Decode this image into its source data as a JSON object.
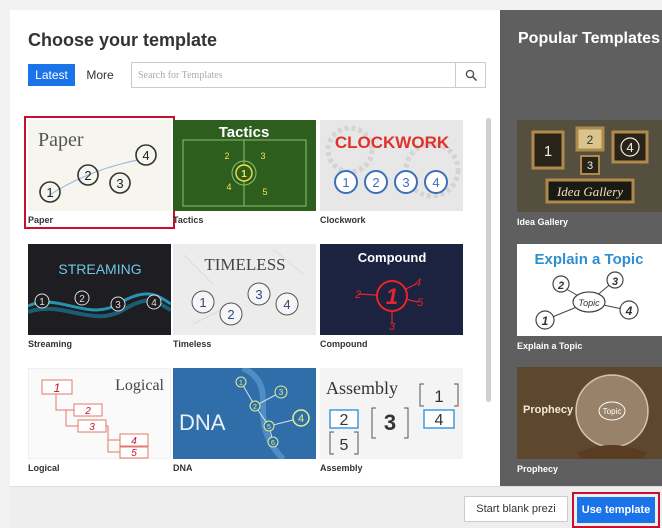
{
  "dialog": {
    "title": "Choose your template",
    "tabs": {
      "latest": "Latest",
      "more": "More"
    },
    "search": {
      "placeholder": "Search for Templates",
      "value": "",
      "icon": "search-icon"
    }
  },
  "templates": [
    {
      "label": "Paper",
      "thumb_title": "Paper",
      "selected": true,
      "nums": [
        "1",
        "2",
        "3",
        "4"
      ]
    },
    {
      "label": "Tactics",
      "thumb_title": "Tactics",
      "nums": [
        "1",
        "2",
        "3",
        "4",
        "5"
      ]
    },
    {
      "label": "Clockwork",
      "thumb_title": "CLOCKWORK",
      "nums": [
        "1",
        "2",
        "3",
        "4"
      ]
    },
    {
      "label": "Streaming",
      "thumb_title": "STREAMING",
      "nums": [
        "1",
        "2",
        "3",
        "4"
      ]
    },
    {
      "label": "Timeless",
      "thumb_title": "TIMELESS",
      "nums": [
        "1",
        "2",
        "3",
        "4"
      ]
    },
    {
      "label": "Compound",
      "thumb_title": "Compound",
      "nums": [
        "1",
        "2",
        "3",
        "4",
        "5"
      ]
    },
    {
      "label": "Logical",
      "thumb_title": "Logical",
      "nums": [
        "1",
        "2",
        "3",
        "4",
        "5"
      ]
    },
    {
      "label": "DNA",
      "thumb_title": "DNA",
      "nums": [
        "1",
        "2",
        "3",
        "4",
        "5",
        "6"
      ]
    },
    {
      "label": "Assembly",
      "thumb_title": "Assembly",
      "nums": [
        "1",
        "2",
        "3",
        "4",
        "5"
      ]
    }
  ],
  "popular": {
    "title": "Popular Templates",
    "items": [
      {
        "label": "Idea Gallery",
        "thumb_title": "Idea Gallery",
        "nums": [
          "1",
          "2",
          "3",
          "4"
        ]
      },
      {
        "label": "Explain a Topic",
        "thumb_title": "Explain a Topic",
        "center": "Topic",
        "nums": [
          "1",
          "2",
          "3",
          "4"
        ]
      },
      {
        "label": "Prophecy",
        "thumb_title": "Prophecy",
        "center": "Topic"
      }
    ]
  },
  "footer": {
    "blank_label": "Start blank prezi",
    "use_label": "Use template"
  },
  "colors": {
    "accent": "#1a73e8",
    "highlight": "#c8102e",
    "sidebar": "#5f5f5f",
    "clockwork_red": "#e0322b",
    "tactics_green": "#2e5e1e",
    "compound_red": "#e5242b",
    "dna_blue": "#2f6ea8"
  }
}
